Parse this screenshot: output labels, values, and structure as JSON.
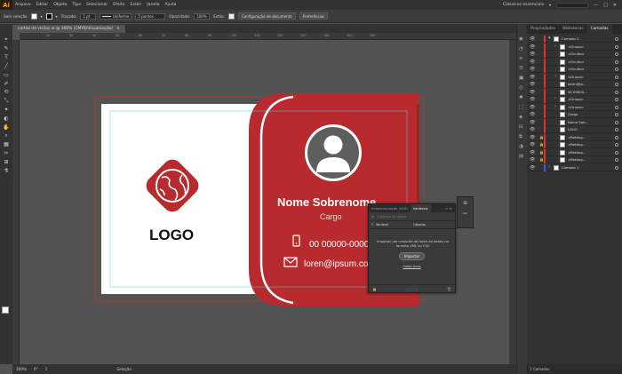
{
  "app": {
    "logo": "Ai"
  },
  "menu": [
    "Arquivo",
    "Editar",
    "Objeto",
    "Tipo",
    "Selecionar",
    "Efeito",
    "Exibir",
    "Janela",
    "Ajuda"
  ],
  "workspace": "Clássicos essenciais",
  "window_buttons": [
    "—",
    "□",
    "✕"
  ],
  "control": {
    "selection": "Sem seleção",
    "stroke_label": "Traçado:",
    "stroke_value": "1 pt",
    "profile": "Uniforme",
    "brush": "5 pontos ·",
    "opacity_label": "Opacidade:",
    "opacity_value": "100%",
    "style_label": "Estilo:",
    "doc_setup": "Configuração de documento",
    "preferences": "Preferências"
  },
  "document_tab": {
    "title": "cartao de visitas.ai @ 300% (CMYK/Visualização)",
    "close": "✕"
  },
  "ruler_ticks": [
    "20",
    "30",
    "40",
    "50",
    "60",
    "70",
    "80",
    "90",
    "100",
    "110",
    "120",
    "130",
    "140",
    "150",
    "160"
  ],
  "card": {
    "logo_text": "LOGO",
    "name": "Nome Sobrenome",
    "role": "Cargo",
    "phone": "00 00000-0000",
    "email": "loren@ipsum.com"
  },
  "variables": {
    "tabs": [
      "Infoestimulação (VAR)",
      "Variáveis"
    ],
    "menu_glyphs": [
      "«",
      "≡"
    ],
    "dataset_label": "Conjunto de dados",
    "col1": "Variável",
    "col2": "Objetos",
    "message": "Importar um conjunto de fonte de dados no formato XML ou CSV",
    "import_button": "Importar",
    "learn_more": "Saiba mais"
  },
  "status": {
    "zoom": "300%",
    "rotation": "0°",
    "page": "1",
    "tool": "Seleção"
  },
  "layers_panel": {
    "tabs": [
      "Propriedades",
      "Bibliotecas",
      "Camadas"
    ],
    "rows": [
      {
        "name": "Camada 2",
        "eye": "👁",
        "lock": "",
        "expander": "▾",
        "color": "#e03030"
      },
      {
        "name": "<Grupo>",
        "eye": "👁",
        "lock": "",
        "expander": "›",
        "color": "#e03030"
      },
      {
        "name": "<Oculto>",
        "eye": "👁",
        "lock": "",
        "expander": "",
        "color": "#e03030"
      },
      {
        "name": "<Oculto>",
        "eye": "👁",
        "lock": "",
        "expander": "",
        "color": "#e03030"
      },
      {
        "name": "<Oculto>",
        "eye": "👁",
        "lock": "",
        "expander": "",
        "color": "#e03030"
      },
      {
        "name": "<Grupo>",
        "eye": "👁",
        "lock": "",
        "expander": "›",
        "color": "#e03030"
      },
      {
        "name": "loren@ip...",
        "eye": "👁",
        "lock": "",
        "expander": "",
        "color": "#e03030"
      },
      {
        "name": "00 00000...",
        "eye": "👁",
        "lock": "",
        "expander": "",
        "color": "#e03030"
      },
      {
        "name": "<Grupo>",
        "eye": "👁",
        "lock": "",
        "expander": "›",
        "color": "#e03030"
      },
      {
        "name": "<Grupo>",
        "eye": "👁",
        "lock": "",
        "expander": "›",
        "color": "#e03030"
      },
      {
        "name": "Cargo",
        "eye": "👁",
        "lock": "",
        "expander": "",
        "color": "#e03030"
      },
      {
        "name": "Nome Sob...",
        "eye": "👁",
        "lock": "",
        "expander": "",
        "color": "#e03030"
      },
      {
        "name": "LOGO",
        "eye": "👁",
        "lock": "",
        "expander": "",
        "color": "#e03030"
      },
      {
        "name": "<Retâng...",
        "eye": "👁",
        "lock": "🔒",
        "expander": "",
        "color": "#e03030"
      },
      {
        "name": "<Retâng...",
        "eye": "👁",
        "lock": "🔒",
        "expander": "",
        "color": "#e03030"
      },
      {
        "name": "<Retâng...",
        "eye": "👁",
        "lock": "🔒",
        "expander": "",
        "color": "#e03030"
      },
      {
        "name": "<Retâng...",
        "eye": "👁",
        "lock": "🔒",
        "expander": "",
        "color": "#e03030"
      },
      {
        "name": "Camada 1",
        "eye": "👁",
        "lock": "",
        "expander": "›",
        "color": "#3b5bdb"
      }
    ],
    "footer": "2 Camadas"
  }
}
